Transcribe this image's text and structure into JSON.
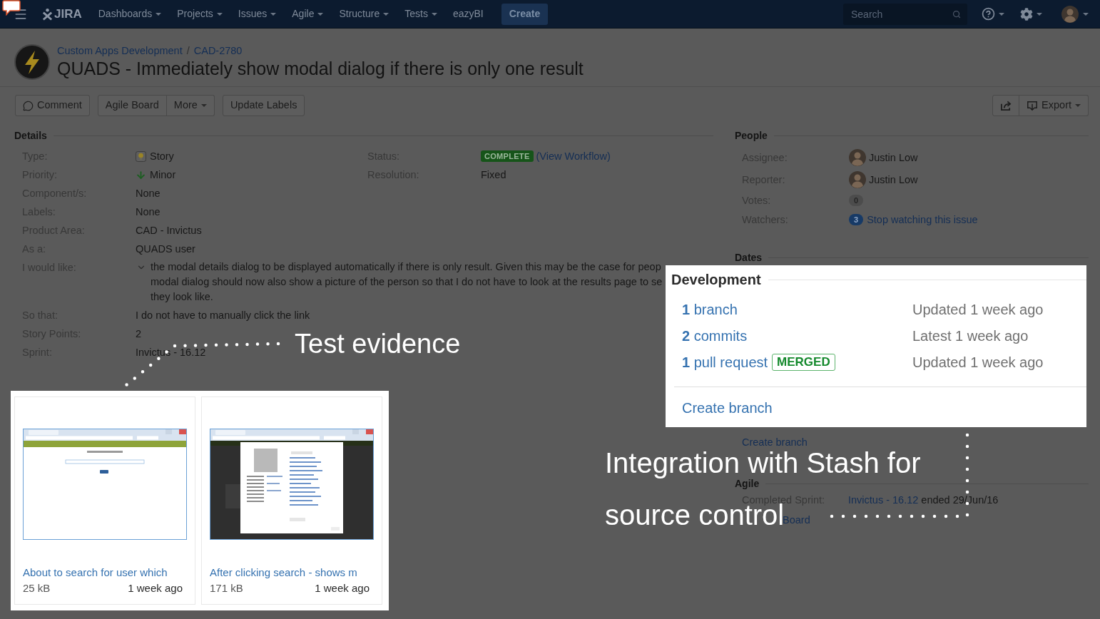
{
  "nav": {
    "logo": "JIRA",
    "menus": [
      {
        "label": "Dashboards",
        "dropdown": true
      },
      {
        "label": "Projects",
        "dropdown": true
      },
      {
        "label": "Issues",
        "dropdown": true
      },
      {
        "label": "Agile",
        "dropdown": true
      },
      {
        "label": "Structure",
        "dropdown": true
      },
      {
        "label": "Tests",
        "dropdown": true
      },
      {
        "label": "eazyBI",
        "dropdown": false
      }
    ],
    "create_button": "Create",
    "search": {
      "placeholder": "Search"
    }
  },
  "issue": {
    "breadcrumbs": [
      "Custom Apps Development",
      "CAD-2780"
    ],
    "separator": "/",
    "title": "QUADS - Immediately show modal dialog if there is only one result"
  },
  "toolbar": {
    "groups": [
      [
        {
          "label": "Comment",
          "kind": "comment",
          "dropdown": false
        }
      ],
      [
        {
          "label": "Agile Board",
          "kind": "plain",
          "dropdown": false
        },
        {
          "label": "More",
          "kind": "plain",
          "dropdown": true
        }
      ],
      [
        {
          "label": "Update Labels",
          "kind": "plain",
          "dropdown": false
        }
      ]
    ],
    "export": {
      "label": "Export",
      "dropdown": true
    }
  },
  "details": {
    "title": "Details",
    "fields": [
      {
        "label": "Type:",
        "value": "Story",
        "kind": "type"
      },
      {
        "label": "Priority:",
        "value": "Minor",
        "kind": "priority"
      },
      {
        "label": "Component/s:",
        "value": "None",
        "kind": "text"
      },
      {
        "label": "Labels:",
        "value": "None",
        "kind": "text"
      }
    ],
    "side_fields": [
      {
        "label": "Status:",
        "value": "COMPLETE",
        "link": "(View Workflow)",
        "kind": "status"
      },
      {
        "label": "Resolution:",
        "value": "Fixed",
        "kind": "text"
      }
    ],
    "custom_fields": [
      {
        "label": "Product Area:",
        "value": "CAD - Invictus",
        "kind": "text"
      },
      {
        "label": "As a:",
        "value": "QUADS user",
        "kind": "text"
      },
      {
        "label": "I would like:",
        "kind": "collapsible",
        "expanded": true,
        "lines": [
          "the modal details dialog to be displayed automatically if there is only result. Given this may be the case for peop",
          "modal dialog should now also show a picture of the person so that I do not have to look at the results page to se",
          "they look like."
        ]
      },
      {
        "label": "So that:",
        "value": "I do not have to manually click the link",
        "kind": "text"
      },
      {
        "label": "Story Points:",
        "value": "2",
        "kind": "text"
      },
      {
        "label": "Sprint:",
        "value": "Invictus - 16.12",
        "kind": "text"
      }
    ]
  },
  "people": {
    "title": "People",
    "fields": [
      {
        "label": "Assignee:",
        "kind": "user",
        "value": "Justin Low"
      },
      {
        "label": "Reporter:",
        "kind": "user",
        "value": "Justin Low"
      },
      {
        "label": "Votes:",
        "kind": "count",
        "count": "0",
        "active": false
      },
      {
        "label": "Watchers:",
        "kind": "count",
        "count": "3",
        "active": true,
        "link": "Stop watching this issue"
      }
    ]
  },
  "dates": {
    "title": "Dates"
  },
  "development": {
    "link": "Create branch"
  },
  "agile": {
    "title": "Agile",
    "fields": [
      {
        "label": "Completed Sprint:",
        "link": "Invictus - 16.12",
        "text": "ended 29/Jun/16"
      }
    ],
    "link": "Board"
  },
  "development_callout": {
    "title": "Development",
    "items": [
      {
        "label": "**1** branch",
        "status": "Updated 1 week ago"
      },
      {
        "label": "**2** commits",
        "status": "Latest 1 week ago"
      },
      {
        "label": "**1** pull request",
        "badge": "MERGED",
        "status": "Updated 1 week ago"
      }
    ],
    "action": "Create branch"
  },
  "attachments_callout": {
    "items": [
      {
        "name": "About to search for user which",
        "size": "25 kB",
        "age": "1 week ago",
        "kind": "search-form"
      },
      {
        "name": "After clicking search - shows m",
        "size": "171 kB",
        "age": "1 week ago",
        "kind": "profile-dialog"
      }
    ]
  },
  "annotations": [
    {
      "lines": [
        "Test evidence"
      ]
    },
    {
      "lines": [
        "Integration with Stash for",
        "source control"
      ]
    }
  ]
}
